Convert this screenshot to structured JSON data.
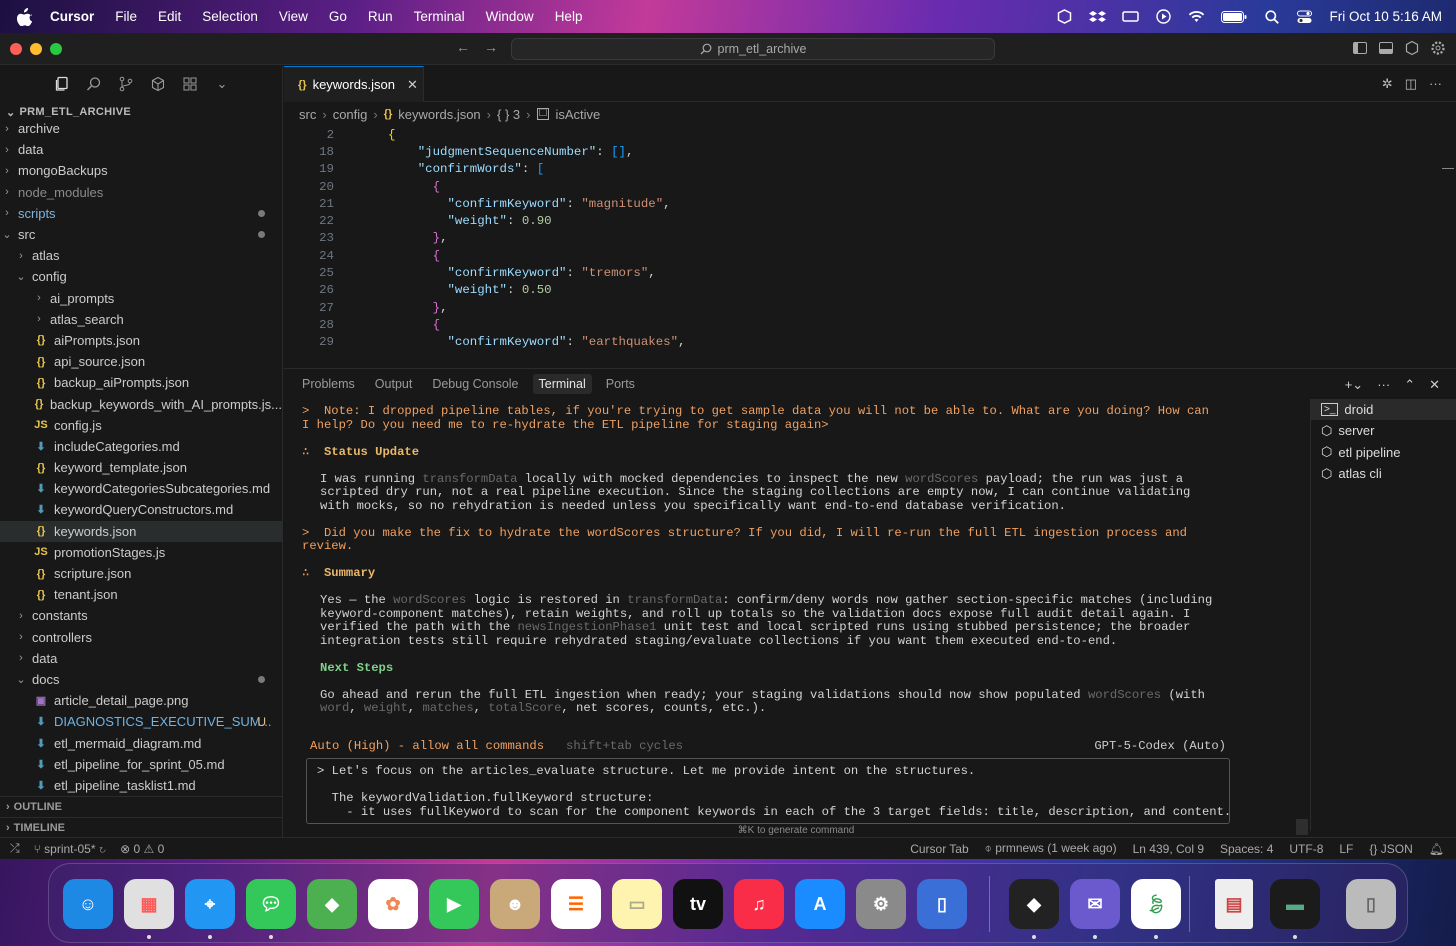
{
  "menubar": {
    "app": "Cursor",
    "items": [
      "File",
      "Edit",
      "Selection",
      "View",
      "Go",
      "Run",
      "Terminal",
      "Window",
      "Help"
    ],
    "clock": "Fri Oct 10  5:16 AM"
  },
  "titlebar": {
    "search": "prm_etl_archive"
  },
  "sidebar": {
    "header": "PRM_ETL_ARCHIVE",
    "items": [
      {
        "label": "archive",
        "kind": "folder",
        "depth": 0,
        "open": false
      },
      {
        "label": "data",
        "kind": "folder",
        "depth": 0,
        "open": false
      },
      {
        "label": "mongoBackups",
        "kind": "folder",
        "depth": 0,
        "open": false
      },
      {
        "label": "node_modules",
        "kind": "folder",
        "depth": 0,
        "open": false
      },
      {
        "label": "scripts",
        "kind": "folder",
        "depth": 0,
        "open": false,
        "dot": true
      },
      {
        "label": "src",
        "kind": "folder",
        "depth": 0,
        "open": true,
        "dot": true
      },
      {
        "label": "atlas",
        "kind": "folder",
        "depth": 1,
        "open": false
      },
      {
        "label": "config",
        "kind": "folder",
        "depth": 1,
        "open": true
      },
      {
        "label": "ai_prompts",
        "kind": "folder",
        "depth": 2,
        "open": false
      },
      {
        "label": "atlas_search",
        "kind": "folder",
        "depth": 2,
        "open": false
      },
      {
        "label": "aiPrompts.json",
        "kind": "json",
        "depth": 2
      },
      {
        "label": "api_source.json",
        "kind": "json",
        "depth": 2
      },
      {
        "label": "backup_aiPrompts.json",
        "kind": "json",
        "depth": 2
      },
      {
        "label": "backup_keywords_with_AI_prompts.js...",
        "kind": "json",
        "depth": 2
      },
      {
        "label": "config.js",
        "kind": "js",
        "depth": 2
      },
      {
        "label": "includeCategories.md",
        "kind": "md",
        "depth": 2
      },
      {
        "label": "keyword_template.json",
        "kind": "json",
        "depth": 2
      },
      {
        "label": "keywordCategoriesSubcategories.md",
        "kind": "md",
        "depth": 2
      },
      {
        "label": "keywordQueryConstructors.md",
        "kind": "md",
        "depth": 2
      },
      {
        "label": "keywords.json",
        "kind": "json",
        "depth": 2,
        "selected": true
      },
      {
        "label": "promotionStages.js",
        "kind": "js",
        "depth": 2
      },
      {
        "label": "scripture.json",
        "kind": "json",
        "depth": 2
      },
      {
        "label": "tenant.json",
        "kind": "json",
        "depth": 2
      },
      {
        "label": "constants",
        "kind": "folder",
        "depth": 1,
        "open": false
      },
      {
        "label": "controllers",
        "kind": "folder",
        "depth": 1,
        "open": false
      },
      {
        "label": "data",
        "kind": "folder",
        "depth": 1,
        "open": false
      },
      {
        "label": "docs",
        "kind": "folder",
        "depth": 1,
        "open": true,
        "dot": true
      },
      {
        "label": "article_detail_page.png",
        "kind": "png",
        "depth": 2
      },
      {
        "label": "DIAGNOSTICS_EXECUTIVE_SUM...",
        "kind": "md",
        "depth": 2,
        "badge": "U",
        "modified": true
      },
      {
        "label": "etl_mermaid_diagram.md",
        "kind": "md",
        "depth": 2
      },
      {
        "label": "etl_pipeline_for_sprint_05.md",
        "kind": "md",
        "depth": 2
      },
      {
        "label": "etl_pipeline_tasklist1.md",
        "kind": "md",
        "depth": 2
      }
    ],
    "outline": "OUTLINE",
    "timeline": "TIMELINE"
  },
  "editor": {
    "tab": "keywords.json",
    "breadcrumb": [
      "src",
      "config",
      "keywords.json",
      "{ } 3",
      "isActive"
    ],
    "lines": [
      {
        "n": "2",
        "t": "{"
      },
      {
        "n": "18",
        "t": "\"judgmentSequenceNumber\": [],"
      },
      {
        "n": "19",
        "t": "\"confirmWords\": ["
      },
      {
        "n": "20",
        "t": "{"
      },
      {
        "n": "21",
        "t": "\"confirmKeyword\": \"magnitude\","
      },
      {
        "n": "22",
        "t": "\"weight\": 0.90"
      },
      {
        "n": "23",
        "t": "},"
      },
      {
        "n": "24",
        "t": "{"
      },
      {
        "n": "25",
        "t": "\"confirmKeyword\": \"tremors\","
      },
      {
        "n": "26",
        "t": "\"weight\": 0.50"
      },
      {
        "n": "27",
        "t": "},"
      },
      {
        "n": "28",
        "t": "{"
      },
      {
        "n": "29",
        "t": "\"confirmKeyword\": \"earthquakes\","
      }
    ]
  },
  "panel": {
    "tabs": [
      "Problems",
      "Output",
      "Debug Console",
      "Terminal",
      "Ports"
    ],
    "active_tab": "Terminal",
    "terminals": [
      "droid",
      "server",
      "etl pipeline",
      "atlas cli"
    ],
    "note": "Note: I dropped pipeline tables, if you're trying to get sample data you will not be able to. What are you doing? How can I help? Do you need me to re-hydrate the ETL pipeline for staging again>",
    "status_update_title": "Status Update",
    "status_update": [
      "I was running ",
      "transformData",
      " locally with mocked dependencies to inspect the new ",
      "wordScores",
      " payload; the run was just a scripted dry run, not a real pipeline execution. Since the staging collections are empty now, I can continue validating with mocks, so no rehydration is needed unless you specifically want end-to-end database verification."
    ],
    "question": "Did you make the fix to hydrate the wordScores structure? If you did, I will re-run the full ETL ingestion process and review.",
    "summary_title": "Summary",
    "summary": [
      "Yes — the ",
      "wordScores",
      " logic is restored in ",
      "transformData",
      ": confirm/deny words now gather section-specific matches (including keyword-component matches), retain weights, and roll up totals so the validation docs expose full audit detail again. I verified the path with the ",
      "newsIngestionPhase1",
      " unit test and local scripted runs using stubbed persistence; the broader integration tests still require rehydrated staging/evaluate collections if you want them executed end-to-end."
    ],
    "next_steps_title": "Next Steps",
    "next_steps": [
      "Go ahead and rerun the full ETL ingestion when ready; your staging validations should now show populated ",
      "wordScores",
      " (with ",
      "word",
      ", ",
      "weight",
      ", ",
      "matches",
      ", ",
      "totalScore",
      ", net scores, counts, etc.)."
    ],
    "mode": "Auto (High) - allow all commands",
    "mode_hint": "shift+tab cycles",
    "model": "GPT-5-Codex (Auto)",
    "input_lines": [
      "> Let's focus on the articles_evaluate structure. Let me provide intent on the structures.",
      "",
      "  The keywordValidation.fullKeyword structure:",
      "    - it uses fullKeyword to scan for the component keywords in each of the 3 target fields: title, description, and content."
    ],
    "cmdk_hint": "⌘K to generate command"
  },
  "statusbar": {
    "branch": "sprint-05*",
    "errors": "0",
    "warnings": "0",
    "cursor_tab": "Cursor Tab",
    "blame": "prmnews (1 week ago)",
    "position": "Ln 439, Col 9",
    "spaces": "Spaces: 4",
    "encoding": "UTF-8",
    "eol": "LF",
    "language": "JSON"
  },
  "dock": [
    "Finder",
    "Launchpad",
    "Safari",
    "Messages",
    "Maps",
    "Photos",
    "FaceTime",
    "Contacts",
    "Reminders",
    "Notes",
    "TV",
    "Music",
    "App Store",
    "System Settings",
    "Simulator",
    "Cursor",
    "Mail",
    "MongoDB Compass",
    "Document",
    "Terminal",
    "Trash"
  ]
}
